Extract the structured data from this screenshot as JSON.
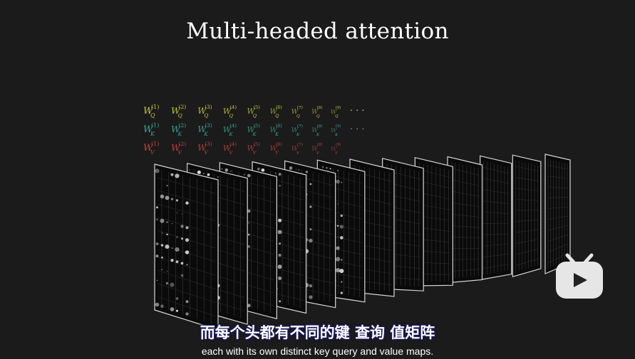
{
  "title": "Multi-headed attention",
  "weight_rows": [
    {
      "letter": "W",
      "sub": "Q",
      "color": "#c8c83a",
      "count": 9,
      "dots": "· · ·"
    },
    {
      "letter": "W",
      "sub": "K",
      "color": "#3aa89a",
      "count": 9,
      "dots": "· · ·"
    },
    {
      "letter": "W",
      "sub": "V",
      "color": "#c2443a",
      "count": 9,
      "dots": ""
    }
  ],
  "subtitle_cn": "而每个头都有不同的键 查询 值矩阵",
  "subtitle_en": "each with its own distinct key query and value maps.",
  "watermark": {
    "icon": "bilibili-tv-icon",
    "color": "#e6e6e6"
  }
}
